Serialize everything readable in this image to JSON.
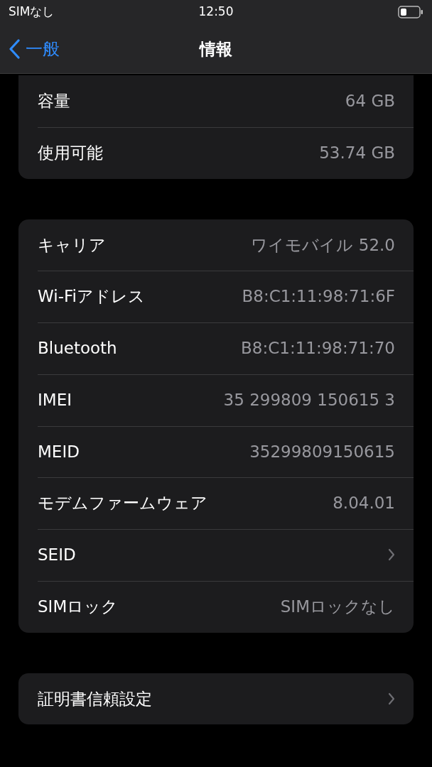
{
  "status_bar": {
    "carrier": "SIMなし",
    "time": "12:50"
  },
  "nav": {
    "back": "一般",
    "title": "情報"
  },
  "groups": [
    {
      "cut_top": true,
      "rows": [
        {
          "kind": "value",
          "label": "容量",
          "value": "64 GB"
        },
        {
          "kind": "value",
          "label": "使用可能",
          "value": "53.74 GB"
        }
      ]
    },
    {
      "cut_top": false,
      "rows": [
        {
          "kind": "value",
          "label": "キャリア",
          "value": "ワイモバイル 52.0"
        },
        {
          "kind": "value",
          "label": "Wi-Fiアドレス",
          "value": "B8:C1:11:98:71:6F"
        },
        {
          "kind": "value",
          "label": "Bluetooth",
          "value": "B8:C1:11:98:71:70"
        },
        {
          "kind": "value",
          "label": "IMEI",
          "value": "35 299809 150615 3"
        },
        {
          "kind": "value",
          "label": "MEID",
          "value": "35299809150615"
        },
        {
          "kind": "value",
          "label": "モデムファームウェア",
          "value": "8.04.01"
        },
        {
          "kind": "link",
          "label": "SEID"
        },
        {
          "kind": "value",
          "label": "SIMロック",
          "value": "SIMロックなし"
        }
      ]
    },
    {
      "cut_top": false,
      "rows": [
        {
          "kind": "link",
          "label": "証明書信頼設定"
        }
      ]
    }
  ]
}
